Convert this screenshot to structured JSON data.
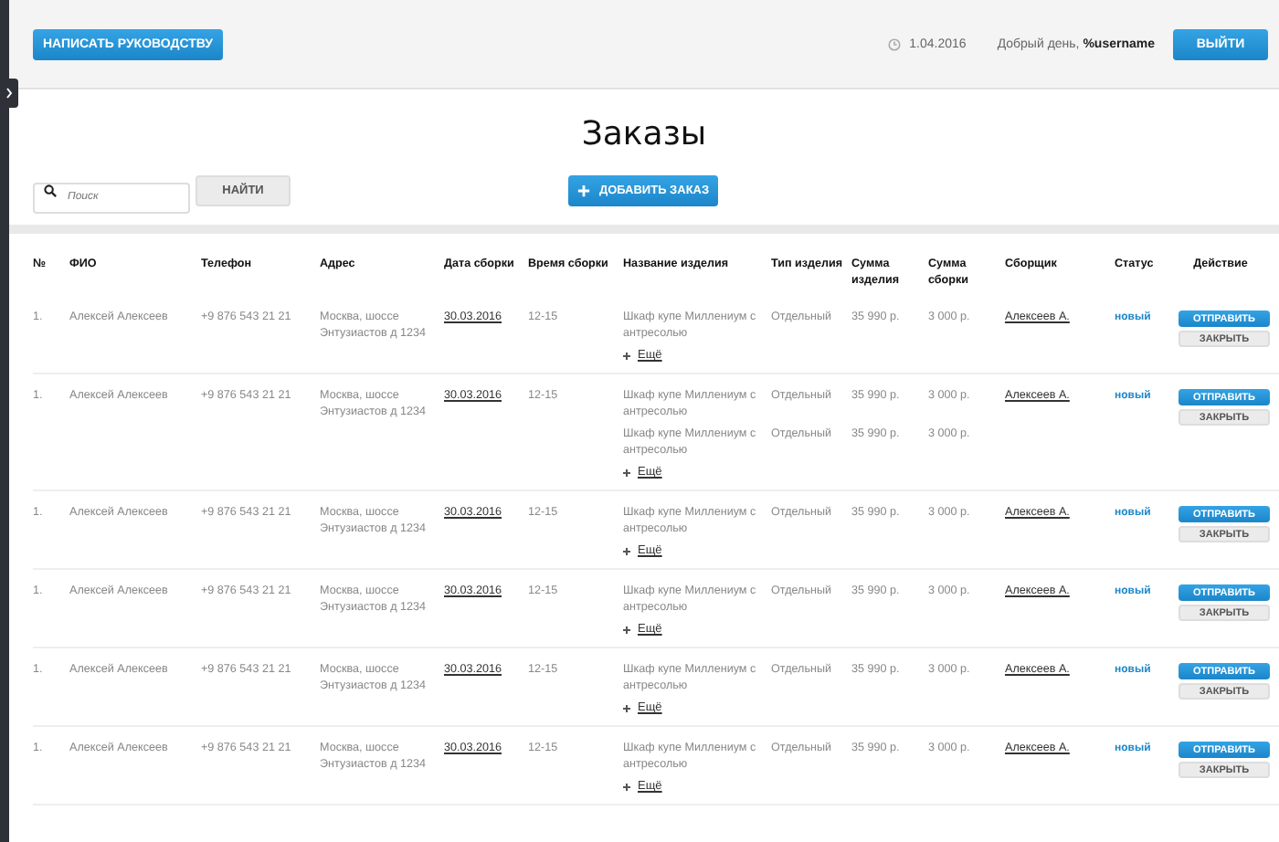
{
  "header": {
    "message_button": "НАПИСАТЬ РУКОВОДСТВУ",
    "date": "1.04.2016",
    "greeting": "Добрый день, **%username**",
    "logout_button": "ВЫЙТИ"
  },
  "title": "Заказы",
  "search": {
    "placeholder": "Поиск",
    "button": "НАЙТИ"
  },
  "add_button": "ДОБАВИТЬ ЗАКАЗ",
  "table": {
    "columns": [
      "№",
      "ФИО",
      "Телефон",
      "Адрес",
      "Дата сборки",
      "Время сборки",
      "Название изделия",
      "Тип изделия",
      "Сумма изделия",
      "Сумма сборки",
      "Сборщик",
      "Статус",
      "Действие"
    ],
    "rows": [
      {
        "num": "1.",
        "name": "Алексей Алексеев",
        "phone": "+9 876 543 21 21",
        "address": "Москва, шоссе Энтузиастов д 1234",
        "date": "30.03.2016",
        "time": "12-15",
        "items": [
          {
            "product": "Шкаф купе Миллениум с антресолью",
            "type": "Отдельный",
            "price": "35 990 р.",
            "assembly": "3 000 р."
          }
        ],
        "more": "Ещё",
        "assembler": "Алексеев А.",
        "status": "новый",
        "send": "ОТПРАВИТЬ",
        "close": "ЗАКРЫТЬ"
      },
      {
        "num": "1.",
        "name": "Алексей Алексеев",
        "phone": "+9 876 543 21 21",
        "address": "Москва, шоссе Энтузиастов д 1234",
        "date": "30.03.2016",
        "time": "12-15",
        "items": [
          {
            "product": "Шкаф купе Миллениум с антресолью",
            "type": "Отдельный",
            "price": "35 990 р.",
            "assembly": "3 000 р."
          },
          {
            "product": "Шкаф купе Миллениум с антресолью",
            "type": "Отдельный",
            "price": "35 990 р.",
            "assembly": "3 000 р."
          }
        ],
        "more": "Ещё",
        "assembler": "Алексеев А.",
        "status": "новый",
        "send": "ОТПРАВИТЬ",
        "close": "ЗАКРЫТЬ"
      },
      {
        "num": "1.",
        "name": "Алексей Алексеев",
        "phone": "+9 876 543 21 21",
        "address": "Москва, шоссе Энтузиастов д 1234",
        "date": "30.03.2016",
        "time": "12-15",
        "items": [
          {
            "product": "Шкаф купе Миллениум с антресолью",
            "type": "Отдельный",
            "price": "35 990 р.",
            "assembly": "3 000 р."
          }
        ],
        "more": "Ещё",
        "assembler": "Алексеев А.",
        "status": "новый",
        "send": "ОТПРАВИТЬ",
        "close": "ЗАКРЫТЬ"
      },
      {
        "num": "1.",
        "name": "Алексей Алексеев",
        "phone": "+9 876 543 21 21",
        "address": "Москва, шоссе Энтузиастов д 1234",
        "date": "30.03.2016",
        "time": "12-15",
        "items": [
          {
            "product": "Шкаф купе Миллениум с антресолью",
            "type": "Отдельный",
            "price": "35 990 р.",
            "assembly": "3 000 р."
          }
        ],
        "more": "Ещё",
        "assembler": "Алексеев А.",
        "status": "новый",
        "send": "ОТПРАВИТЬ",
        "close": "ЗАКРЫТЬ"
      },
      {
        "num": "1.",
        "name": "Алексей Алексеев",
        "phone": "+9 876 543 21 21",
        "address": "Москва, шоссе Энтузиастов д 1234",
        "date": "30.03.2016",
        "time": "12-15",
        "items": [
          {
            "product": "Шкаф купе Миллениум с антресолью",
            "type": "Отдельный",
            "price": "35 990 р.",
            "assembly": "3 000 р."
          }
        ],
        "more": "Ещё",
        "assembler": "Алексеев А.",
        "status": "новый",
        "send": "ОТПРАВИТЬ",
        "close": "ЗАКРЫТЬ"
      },
      {
        "num": "1.",
        "name": "Алексей Алексеев",
        "phone": "+9 876 543 21 21",
        "address": "Москва, шоссе Энтузиастов д 1234",
        "date": "30.03.2016",
        "time": "12-15",
        "items": [
          {
            "product": "Шкаф купе Миллениум с антресолью",
            "type": "Отдельный",
            "price": "35 990 р.",
            "assembly": "3 000 р."
          }
        ],
        "more": "Ещё",
        "assembler": "Алексеев А.",
        "status": "новый",
        "send": "ОТПРАВИТЬ",
        "close": "ЗАКРЫТЬ"
      }
    ]
  }
}
